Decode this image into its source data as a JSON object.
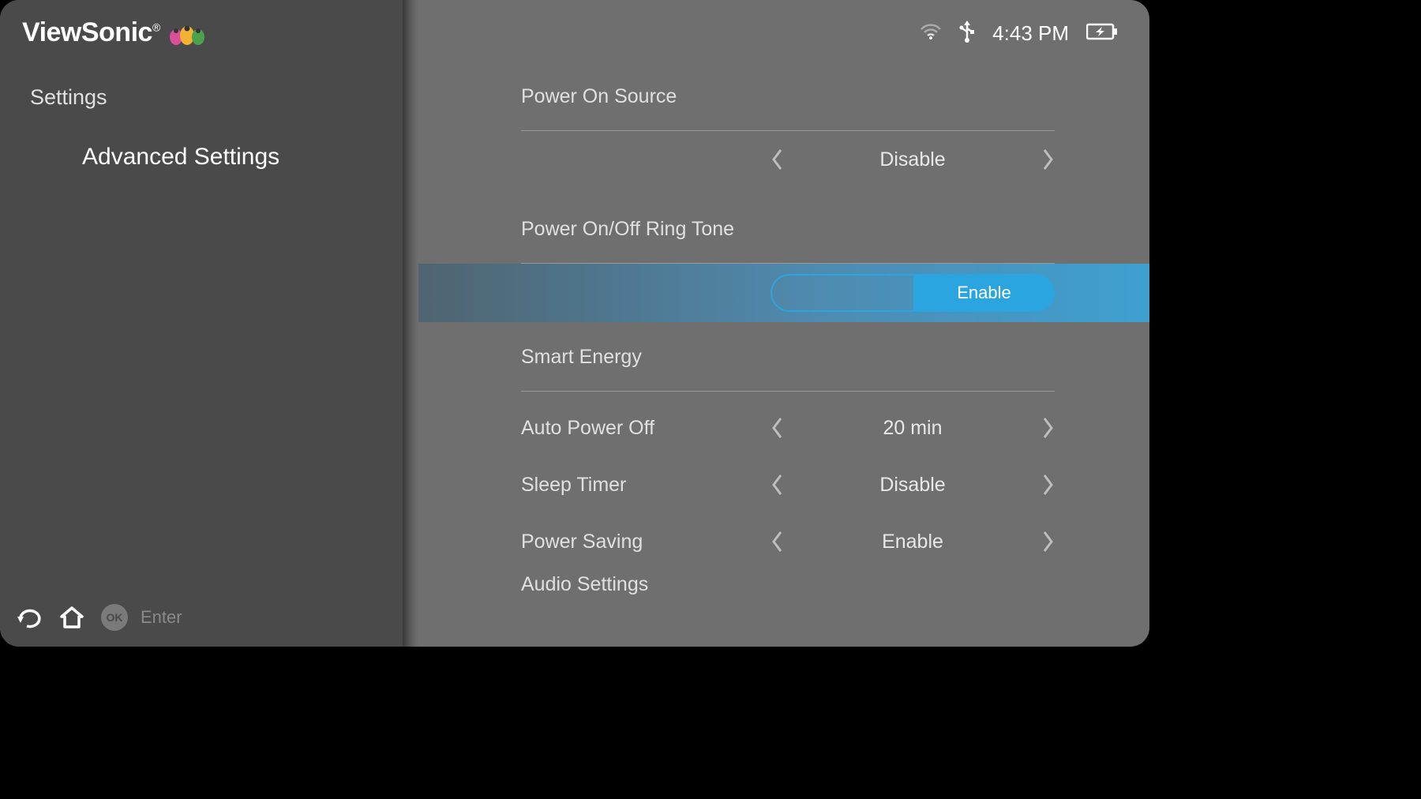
{
  "brand": "ViewSonic",
  "sidebar": {
    "title": "Settings",
    "sub": "Advanced Settings"
  },
  "footer": {
    "ok": "OK",
    "enter": "Enter"
  },
  "status": {
    "time": "4:43 PM"
  },
  "sections": {
    "powerOnSource": {
      "header": "Power On Source",
      "value": "Disable"
    },
    "ringTone": {
      "header": "Power On/Off Ring Tone",
      "value": "Enable"
    },
    "smartEnergy": {
      "header": "Smart Energy",
      "items": [
        {
          "label": "Auto Power Off",
          "value": "20 min"
        },
        {
          "label": "Sleep Timer",
          "value": "Disable"
        },
        {
          "label": "Power Saving",
          "value": "Enable"
        }
      ]
    },
    "audio": {
      "header": "Audio Settings"
    }
  }
}
